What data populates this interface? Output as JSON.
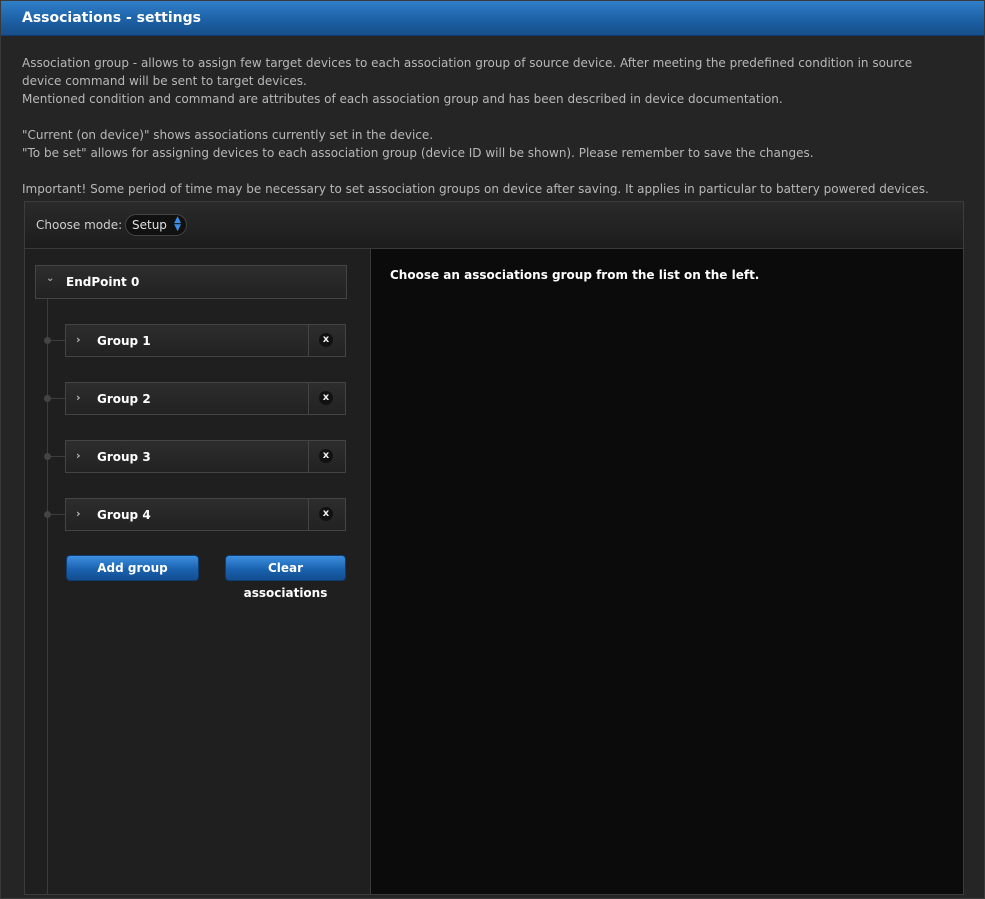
{
  "window": {
    "title": "Associations - settings"
  },
  "description": {
    "line1": "Association group - allows to assign few target devices to each association group of source device. After meeting the predefined condition in source device command will be sent to target devices.",
    "line2": "Mentioned condition and command are attributes of each association group and has been described in device documentation.",
    "line3": "\"Current (on device)\" shows associations currently set in the device.",
    "line4": "\"To be set\" allows for assigning devices to each association group (device ID will be shown). Please remember to save the changes.",
    "line5": "Important! Some period of time may be necessary to set association groups on device after saving. It applies in particular to battery powered devices."
  },
  "toolbar": {
    "mode_label": "Choose mode:",
    "mode_value": "Setup"
  },
  "tree": {
    "endpoint_label": "EndPoint 0",
    "groups": [
      {
        "label": "Group 1",
        "delete": "x"
      },
      {
        "label": "Group 2",
        "delete": "x"
      },
      {
        "label": "Group 3",
        "delete": "x"
      },
      {
        "label": "Group 4",
        "delete": "x"
      }
    ]
  },
  "actions": {
    "add_group": "Add group",
    "clear_associations": "Clear associations"
  },
  "main": {
    "message": "Choose an associations group from the list on the left."
  },
  "colors": {
    "title_bar": "#1c5fa3",
    "button": "#1a62b0",
    "background": "#252525"
  }
}
